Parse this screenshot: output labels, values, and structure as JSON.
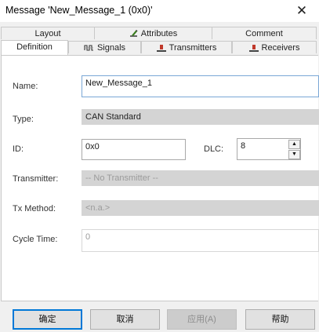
{
  "window": {
    "title": "Message 'New_Message_1 (0x0)'",
    "close_glyph": "✕"
  },
  "tabs_row1": [
    {
      "label": "Layout"
    },
    {
      "label": "Attributes",
      "icon": "attributes-icon"
    },
    {
      "label": "Comment"
    }
  ],
  "tabs_row2": [
    {
      "label": "Definition",
      "active": true
    },
    {
      "label": "Signals",
      "icon": "signals-icon"
    },
    {
      "label": "Transmitters",
      "icon": "transmitter-icon"
    },
    {
      "label": "Receivers",
      "icon": "receiver-icon"
    }
  ],
  "form": {
    "name_label": "Name:",
    "name_value": "New_Message_1",
    "type_label": "Type:",
    "type_value": "CAN Standard",
    "id_label": "ID:",
    "id_value": "0x0",
    "dlc_label": "DLC:",
    "dlc_value": "8",
    "transmitter_label": "Transmitter:",
    "transmitter_value": "-- No Transmitter --",
    "tx_method_label": "Tx Method:",
    "tx_method_value": "<n.a.>",
    "cycle_time_label": "Cycle Time:",
    "cycle_time_value": "0"
  },
  "buttons": {
    "ok": "确定",
    "cancel": "取消",
    "apply": "应用(A)",
    "help": "帮助"
  },
  "colors": {
    "accent": "#0078d7",
    "transmitter_icon": "#c0392b",
    "attributes_icon": "#3a7d1f"
  }
}
